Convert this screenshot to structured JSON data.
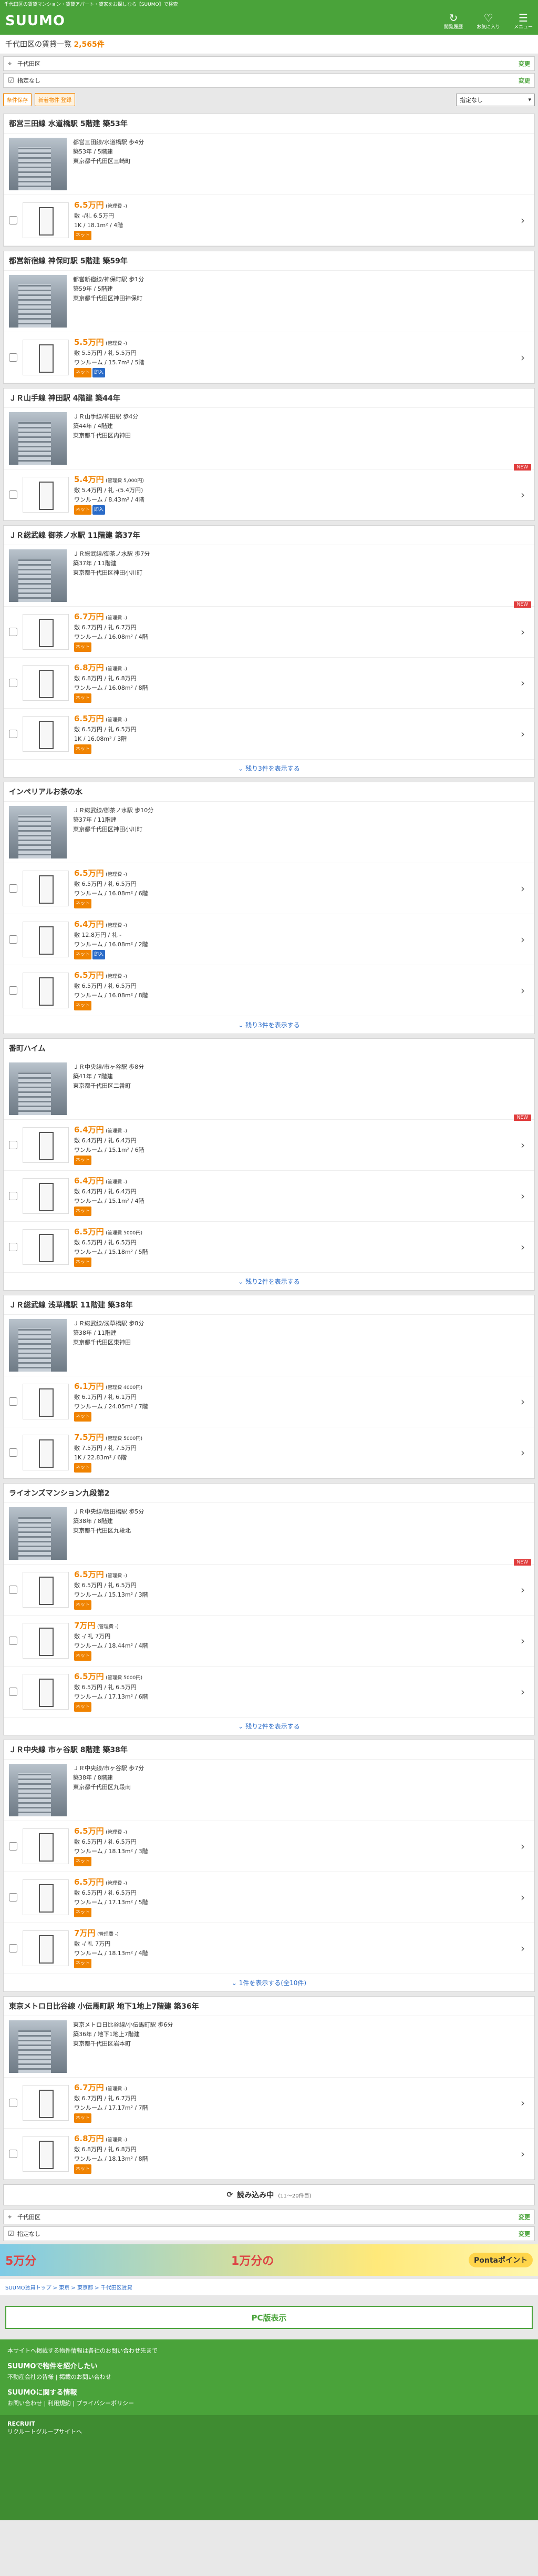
{
  "topbar": "千代田区の賃貸マンション・賃貸アパート・貸家をお探しなら【SUUMO】で検索",
  "header": {
    "logo": "SUUMO",
    "icons": [
      {
        "name": "history-icon",
        "label": "閲覧履歴"
      },
      {
        "name": "favorite-icon",
        "label": "お気に入り"
      },
      {
        "name": "menu-icon",
        "label": "メニュー"
      }
    ]
  },
  "title": {
    "text": "千代田区の賃貸一覧",
    "count": "2,565件"
  },
  "filters": [
    {
      "icon": "pin-icon",
      "label": "千代田区",
      "link": "変更"
    },
    {
      "icon": "check-icon",
      "label": "指定なし",
      "link": "変更"
    }
  ],
  "tools": {
    "btn1": "条件保存",
    "btn2": "新着物件\n登録",
    "sort": "指定なし"
  },
  "cards": [
    {
      "name": "都営三田線 水道橋駅 5階建 築53年",
      "info": [
        "都営三田線/水道橋駅 歩4分",
        "築53年 / 5階建",
        "東京都千代田区三崎町"
      ],
      "new": false,
      "rooms": [
        {
          "rent": "6.5万円",
          "fee": "(管理費 -)",
          "detail": "敷 -/礼 6.5万円",
          "layout": "1K / 18.1m² / 4階",
          "tags": [
            "ネット"
          ]
        }
      ]
    },
    {
      "name": "都営新宿線 神保町駅 5階建 築59年",
      "info": [
        "都営新宿線/神保町駅 歩1分",
        "築59年 / 5階建",
        "東京都千代田区神田神保町"
      ],
      "new": false,
      "rooms": [
        {
          "rent": "5.5万円",
          "fee": "(管理費 -)",
          "detail": "敷 5.5万円 / 礼 5.5万円",
          "layout": "ワンルーム / 15.7m² / 5階",
          "tags": [
            "ネット",
            "即入"
          ]
        }
      ]
    },
    {
      "name": "ＪＲ山手線 神田駅 4階建 築44年",
      "info": [
        "ＪＲ山手線/神田駅 歩4分",
        "築44年 / 4階建",
        "東京都千代田区内神田"
      ],
      "new": true,
      "rooms": [
        {
          "rent": "5.4万円",
          "fee": "(管理費 5,000円)",
          "detail": "敷 5.4万円 / 礼 -(5.4万円)",
          "layout": "ワンルーム / 8.43m² / 4階",
          "tags": [
            "ネット",
            "即入"
          ]
        }
      ]
    },
    {
      "name": "ＪＲ総武線 御茶ノ水駅 11階建 築37年",
      "info": [
        "ＪＲ総武線/御茶ノ水駅 歩7分",
        "築37年 / 11階建",
        "東京都千代田区神田小川町"
      ],
      "new": true,
      "rooms": [
        {
          "rent": "6.7万円",
          "fee": "(管理費 -)",
          "detail": "敷 6.7万円 / 礼 6.7万円",
          "layout": "ワンルーム / 16.08m² / 4階",
          "tags": [
            "ネット"
          ]
        },
        {
          "rent": "6.8万円",
          "fee": "(管理費 -)",
          "detail": "敷 6.8万円 / 礼 6.8万円",
          "layout": "ワンルーム / 16.08m² / 8階",
          "tags": [
            "ネット"
          ]
        },
        {
          "rent": "6.5万円",
          "fee": "(管理費 -)",
          "detail": "敷 6.5万円 / 礼 6.5万円",
          "layout": "1K / 16.08m² / 3階",
          "tags": [
            "ネット"
          ]
        }
      ],
      "more": "残り3件を表示する"
    },
    {
      "name": "インペリアルお茶の水",
      "info": [
        "ＪＲ総武線/御茶ノ水駅 歩10分",
        "築37年 / 11階建",
        "東京都千代田区神田小川町"
      ],
      "new": false,
      "rooms": [
        {
          "rent": "6.5万円",
          "fee": "(管理費 -)",
          "detail": "敷 6.5万円 / 礼 6.5万円",
          "layout": "ワンルーム / 16.08m² / 6階",
          "tags": [
            "ネット"
          ]
        },
        {
          "rent": "6.4万円",
          "fee": "(管理費 -)",
          "detail": "敷 12.8万円 / 礼 -",
          "layout": "ワンルーム / 16.08m² / 2階",
          "tags": [
            "ネット",
            "即入"
          ]
        },
        {
          "rent": "6.5万円",
          "fee": "(管理費 -)",
          "detail": "敷 6.5万円 / 礼 6.5万円",
          "layout": "ワンルーム / 16.08m² / 8階",
          "tags": [
            "ネット"
          ]
        }
      ],
      "more": "残り3件を表示する"
    },
    {
      "name": "番町ハイム",
      "info": [
        "ＪＲ中央線/市ヶ谷駅 歩8分",
        "築41年 / 7階建",
        "東京都千代田区二番町"
      ],
      "new": true,
      "rooms": [
        {
          "rent": "6.4万円",
          "fee": "(管理費 -)",
          "detail": "敷 6.4万円 / 礼 6.4万円",
          "layout": "ワンルーム / 15.1m² / 6階",
          "tags": [
            "ネット"
          ]
        },
        {
          "rent": "6.4万円",
          "fee": "(管理費 -)",
          "detail": "敷 6.4万円 / 礼 6.4万円",
          "layout": "ワンルーム / 15.1m² / 4階",
          "tags": [
            "ネット"
          ]
        },
        {
          "rent": "6.5万円",
          "fee": "(管理費 5000円)",
          "detail": "敷 6.5万円 / 礼 6.5万円",
          "layout": "ワンルーム / 15.18m² / 5階",
          "tags": [
            "ネット"
          ]
        }
      ],
      "more": "残り2件を表示する"
    },
    {
      "name": "ＪＲ総武線 浅草橋駅 11階建 築38年",
      "info": [
        "ＪＲ総武線/浅草橋駅 歩8分",
        "築38年 / 11階建",
        "東京都千代田区東神田"
      ],
      "new": false,
      "rooms": [
        {
          "rent": "6.1万円",
          "fee": "(管理費 4000円)",
          "detail": "敷 6.1万円 / 礼 6.1万円",
          "layout": "ワンルーム / 24.05m² / 7階",
          "tags": [
            "ネット"
          ]
        },
        {
          "rent": "7.5万円",
          "fee": "(管理費 5000円)",
          "detail": "敷 7.5万円 / 礼 7.5万円",
          "layout": "1K / 22.83m² / 6階",
          "tags": [
            "ネット"
          ]
        }
      ]
    },
    {
      "name": "ライオンズマンション九段第2",
      "info": [
        "ＪＲ中央線/飯田橋駅 歩5分",
        "築38年 / 8階建",
        "東京都千代田区九段北"
      ],
      "new": true,
      "rooms": [
        {
          "rent": "6.5万円",
          "fee": "(管理費 -)",
          "detail": "敷 6.5万円 / 礼 6.5万円",
          "layout": "ワンルーム / 15.13m² / 3階",
          "tags": [
            "ネット"
          ]
        },
        {
          "rent": "7万円",
          "fee": "(管理費 -)",
          "detail": "敷 -/ 礼 7万円",
          "layout": "ワンルーム / 18.44m² / 4階",
          "tags": [
            "ネット"
          ]
        },
        {
          "rent": "6.5万円",
          "fee": "(管理費 5000円)",
          "detail": "敷 6.5万円 / 礼 6.5万円",
          "layout": "ワンルーム / 17.13m² / 6階",
          "tags": [
            "ネット"
          ]
        }
      ],
      "more": "残り2件を表示する"
    },
    {
      "name": "ＪＲ中央線 市ヶ谷駅 8階建 築38年",
      "info": [
        "ＪＲ中央線/市ヶ谷駅 歩7分",
        "築38年 / 8階建",
        "東京都千代田区九段南"
      ],
      "new": false,
      "rooms": [
        {
          "rent": "6.5万円",
          "fee": "(管理費 -)",
          "detail": "敷 6.5万円 / 礼 6.5万円",
          "layout": "ワンルーム / 18.13m² / 3階",
          "tags": [
            "ネット"
          ]
        },
        {
          "rent": "6.5万円",
          "fee": "(管理費 -)",
          "detail": "敷 6.5万円 / 礼 6.5万円",
          "layout": "ワンルーム / 17.13m² / 5階",
          "tags": [
            "ネット"
          ]
        },
        {
          "rent": "7万円",
          "fee": "(管理費 -)",
          "detail": "敷 -/ 礼 7万円",
          "layout": "ワンルーム / 18.13m² / 4階",
          "tags": [
            "ネット"
          ]
        }
      ],
      "more": "1件を表示する(全10件)"
    },
    {
      "name": "東京メトロ日比谷線 小伝馬町駅 地下1地上7階建 築36年",
      "info": [
        "東京メトロ日比谷線/小伝馬町駅 歩6分",
        "築36年 / 地下1地上7階建",
        "東京都千代田区岩本町"
      ],
      "new": false,
      "rooms": [
        {
          "rent": "6.7万円",
          "fee": "(管理費 -)",
          "detail": "敷 6.7万円 / 礼 6.7万円",
          "layout": "ワンルーム / 17.17m² / 7階",
          "tags": [
            "ネット"
          ]
        },
        {
          "rent": "6.8万円",
          "fee": "(管理費 -)",
          "detail": "敷 6.8万円 / 礼 6.8万円",
          "layout": "ワンルーム / 18.13m² / 8階",
          "tags": [
            "ネット"
          ]
        }
      ]
    }
  ],
  "loading": {
    "text": "読み込み中",
    "sub": "(11～20件目)"
  },
  "banner": {
    "left": "5万分",
    "mid": "1万分の",
    "right": "Pontaポイント"
  },
  "breadcrumb": "SUUMO賃貸トップ > 東京 > 東京都 > 千代田区賃貸",
  "pc": "PC版表示",
  "footer": {
    "note": "本サイトへ掲載する物件情報は各社のお問い合わせ先まで",
    "h1": "SUUMOで物件を紹介したい",
    "l1": "不動産会社の皆様 | 掲載のお問い合わせ",
    "h2": "SUUMOに関する情報",
    "l2": "お問い合わせ | 利用規約 | プライバシーポリシー",
    "brand": "RECRUIT",
    "group": "リクルートグループサイトへ"
  }
}
